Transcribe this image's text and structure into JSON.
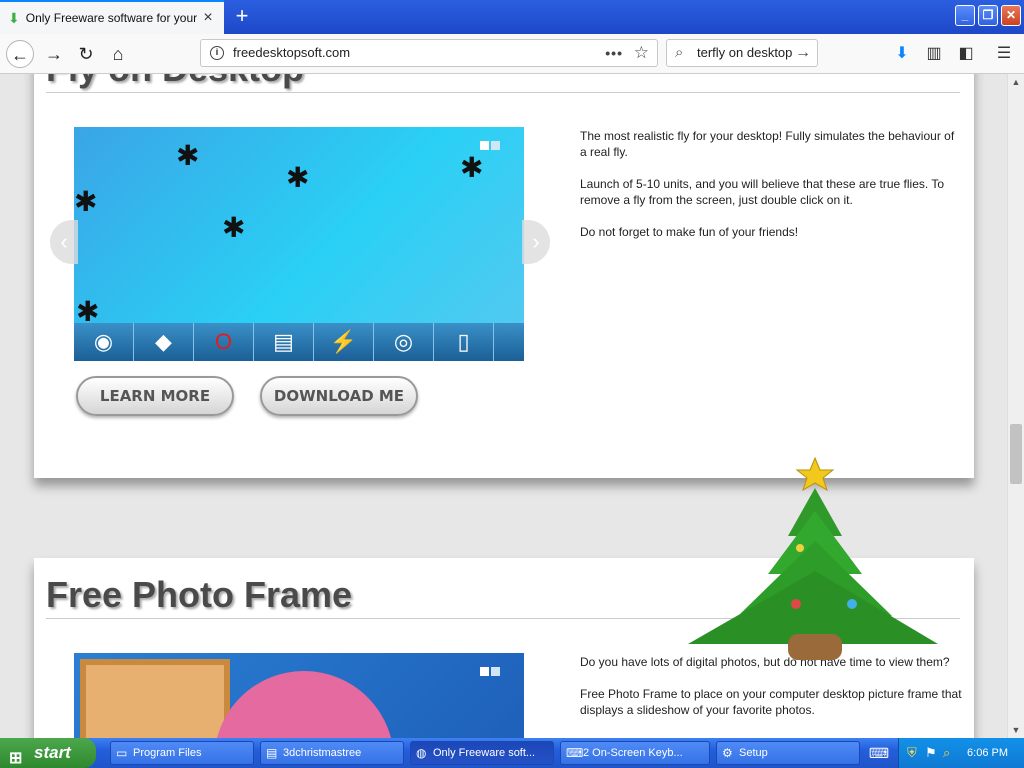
{
  "browser": {
    "tab_title": "Only Freeware software for your",
    "url": "freedesktopsoft.com",
    "search_value": "terfly on desktop",
    "new_tab_symbol": "+"
  },
  "window_controls": {
    "minimize": "_",
    "maximize": "❐",
    "close": "✕"
  },
  "sections": [
    {
      "title": "Fly on Desktop",
      "description": [
        "The most realistic fly for your desktop! Fully simulates the behaviour of a real fly.",
        "Launch of 5-10 units, and you will believe that these are true flies. To remove a fly from the screen, just double click on it.",
        "Do not forget to make fun of your friends!"
      ],
      "buttons": {
        "learn_more": "LEARN MORE",
        "download": "DOWNLOAD ME"
      }
    },
    {
      "title": "Free Photo Frame",
      "description": [
        "Do you have lots of digital photos, but do not have time to view them?",
        "Free Photo Frame to place on your computer desktop picture frame that displays a slideshow of your favorite photos."
      ]
    }
  ],
  "taskbar": {
    "start_label": "start",
    "items": [
      {
        "label": "Program Files",
        "icon": "folder-icon"
      },
      {
        "label": "3dchristmastree",
        "icon": "archive-icon"
      },
      {
        "label": "Only Freeware soft...",
        "icon": "firefox-icon"
      },
      {
        "label": "2 On-Screen Keyb...",
        "icon": "keyboard-icon"
      },
      {
        "label": "Setup",
        "icon": "setup-icon"
      }
    ],
    "clock": "6:06 PM"
  }
}
